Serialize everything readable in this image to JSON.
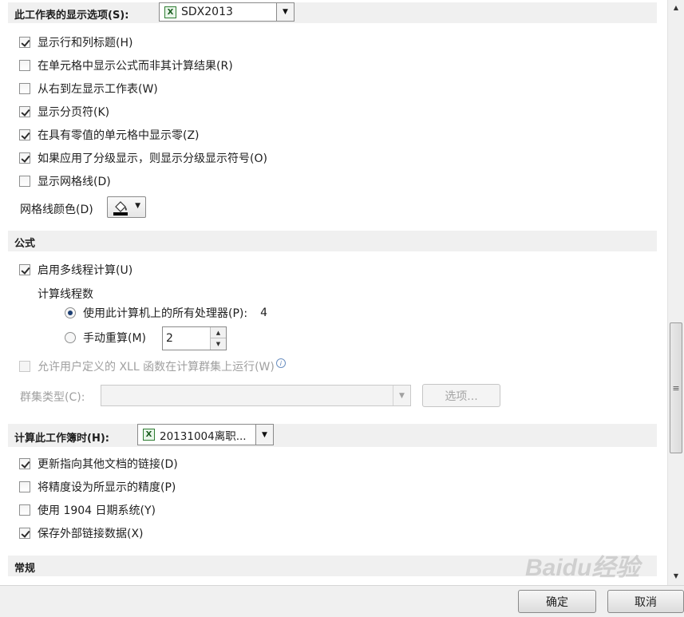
{
  "worksheet_display": {
    "header_label": "此工作表的显示选项(S):",
    "sheet_value": "SDX2013",
    "options": [
      {
        "label": "显示行和列标题(H)",
        "checked": true
      },
      {
        "label": "在单元格中显示公式而非其计算结果(R)",
        "checked": false
      },
      {
        "label": "从右到左显示工作表(W)",
        "checked": false
      },
      {
        "label": "显示分页符(K)",
        "checked": true
      },
      {
        "label": "在具有零值的单元格中显示零(Z)",
        "checked": true
      },
      {
        "label": "如果应用了分级显示，则显示分级显示符号(O)",
        "checked": true
      },
      {
        "label": "显示网格线(D)",
        "checked": false
      }
    ],
    "gridline_color_label": "网格线颜色(D)"
  },
  "formulas": {
    "header": "公式",
    "multithread_label": "启用多线程计算(U)",
    "multithread_checked": true,
    "thread_count_label": "计算线程数",
    "use_all_processors_label": "使用此计算机上的所有处理器(P):",
    "processor_count": "4",
    "manual_label": "手动重算(M)",
    "manual_value": "2",
    "xll_label": "允许用户定义的 XLL 函数在计算群集上运行(W)",
    "cluster_type_label": "群集类型(C):",
    "cluster_value": "",
    "options_button": "选项..."
  },
  "workbook_calc": {
    "header_label": "计算此工作簿时(H):",
    "workbook_value": "20131004离职...",
    "options": [
      {
        "label": "更新指向其他文档的链接(D)",
        "checked": true
      },
      {
        "label": "将精度设为所显示的精度(P)",
        "checked": false
      },
      {
        "label": "使用 1904 日期系统(Y)",
        "checked": false
      },
      {
        "label": "保存外部链接数据(X)",
        "checked": true
      }
    ]
  },
  "general": {
    "header": "常规"
  },
  "footer": {
    "ok_label": "确定",
    "cancel_label": "取消"
  },
  "watermark": "Baidu经验"
}
